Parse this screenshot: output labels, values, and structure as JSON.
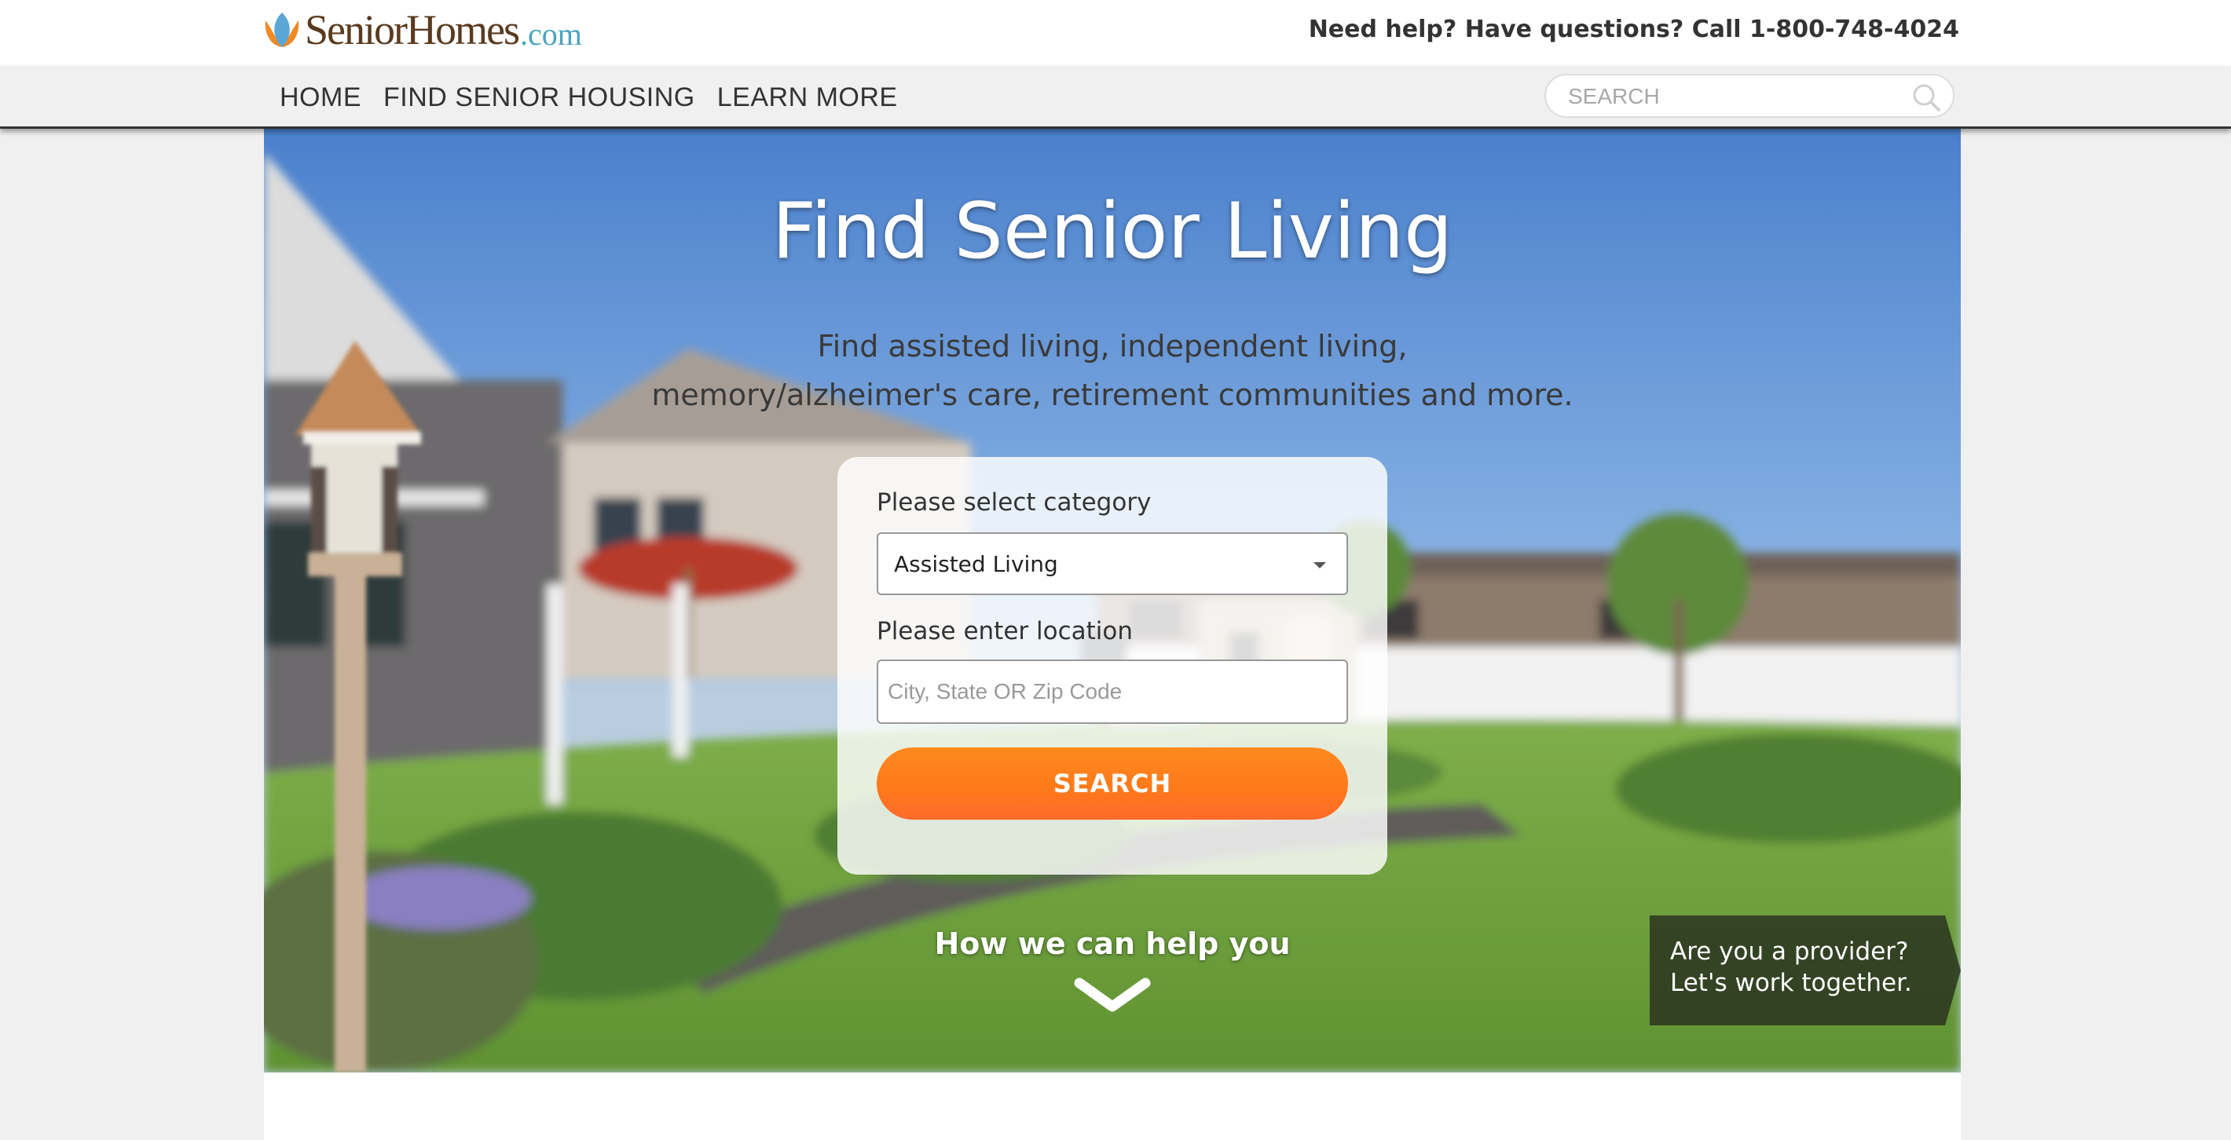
{
  "header": {
    "logo_word": "SeniorHomes",
    "logo_suffix": ".com",
    "help_text": "Need help? Have questions? Call 1-800-748-4024"
  },
  "nav": {
    "items": [
      {
        "label": "HOME"
      },
      {
        "label": "FIND SENIOR HOUSING"
      },
      {
        "label": "LEARN MORE"
      }
    ],
    "search_placeholder": "SEARCH"
  },
  "hero": {
    "title": "Find Senior Living",
    "subtitle_line1": "Find assisted living, independent living,",
    "subtitle_line2": "memory/alzheimer's care, retirement communities and more."
  },
  "form": {
    "category_label": "Please select category",
    "category_value": "Assisted Living",
    "location_label": "Please enter location",
    "location_placeholder": "City, State OR Zip Code",
    "search_button": "SEARCH"
  },
  "help_section": {
    "label": "How we can help you"
  },
  "provider": {
    "line1": "Are you a provider?",
    "line2": "Let's work together."
  },
  "colors": {
    "accent_orange": "#ff7a1a",
    "logo_brown": "#5a3a1e",
    "logo_blue": "#4aa3c0"
  }
}
